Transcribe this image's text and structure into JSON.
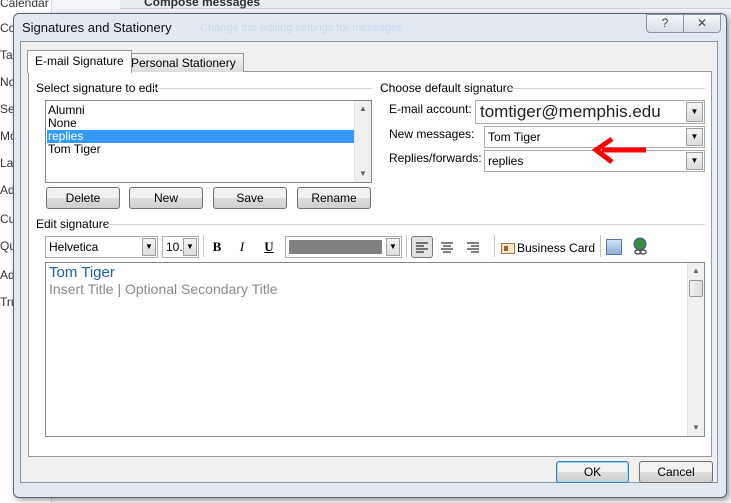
{
  "background": {
    "nav_fragments": [
      "Calendar",
      "Cor",
      "Tas",
      "Not",
      "Sea",
      "Mo",
      "Lan",
      "Adv",
      "Cus",
      "Qui",
      "Add",
      "Tru"
    ],
    "header": "Compose messages",
    "faded_text": "Change the editing settings for messages"
  },
  "dialog": {
    "title": "Signatures and Stationery",
    "help_label": "?",
    "close_label": "✕",
    "tabs": [
      {
        "label": "E-mail Signature",
        "active": true
      },
      {
        "label": "Personal Stationery",
        "active": false
      }
    ],
    "select_section": "Select signature to edit",
    "signatures": [
      "Alumni",
      "None",
      "replies",
      "Tom Tiger"
    ],
    "selected_signature": "replies",
    "buttons": {
      "delete": "Delete",
      "new": "New",
      "save": "Save",
      "rename": "Rename"
    },
    "default_section": "Choose default signature",
    "email_account_label": "E-mail account:",
    "email_account": "tomtiger@memphis.edu",
    "new_messages_label": "New messages:",
    "new_messages": "Tom Tiger",
    "replies_label": "Replies/forwards:",
    "replies": "replies",
    "edit_section": "Edit signature",
    "toolbar": {
      "font": "Helvetica",
      "size": "10.",
      "bold": "B",
      "italic": "I",
      "underline": "U",
      "font_color": "#808080",
      "business_card": "Business Card"
    },
    "signature_lines": [
      "Tom Tiger",
      "Insert Title | Optional Secondary Title"
    ],
    "ok": "OK",
    "cancel": "Cancel"
  },
  "colors": {
    "arrow": "#ff0000",
    "selection": "#3399ff",
    "name_text": "#1f5fa8",
    "title_text": "#8a8a8a"
  }
}
